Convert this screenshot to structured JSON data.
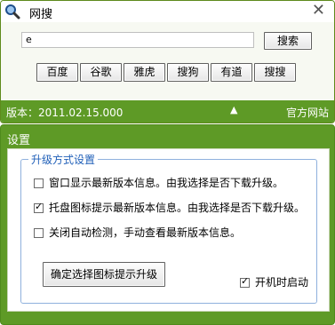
{
  "window": {
    "title": "网搜",
    "close_label": "✕"
  },
  "search": {
    "value": "e",
    "placeholder": "",
    "button_label": "搜索"
  },
  "engines": [
    "百度",
    "谷歌",
    "雅虎",
    "搜狗",
    "有道",
    "搜搜"
  ],
  "footer": {
    "version": "版本：2011.02.15.000",
    "collapse_symbol": "▲",
    "official_site": "官方网站"
  },
  "settings": {
    "title": "设置",
    "group_title": "升级方式设置",
    "options": [
      {
        "label": "窗口显示最新版本信息。由我选择是否下载升级。",
        "checked": false
      },
      {
        "label": "托盘图标提示最新版本信息。由我选择是否下载升级。",
        "checked": true
      },
      {
        "label": "关闭自动检测，手动查看最新版本信息。",
        "checked": false
      }
    ],
    "confirm_button": "确定选择图标提示升级",
    "startup": {
      "label": "开机时启动",
      "checked": true
    }
  },
  "colors": {
    "accent_green": "#5e9a26",
    "group_blue": "#1f5fb8"
  },
  "icons": {
    "title": "magnifier-icon",
    "close": "close-icon",
    "collapse": "chevron-up-icon"
  }
}
